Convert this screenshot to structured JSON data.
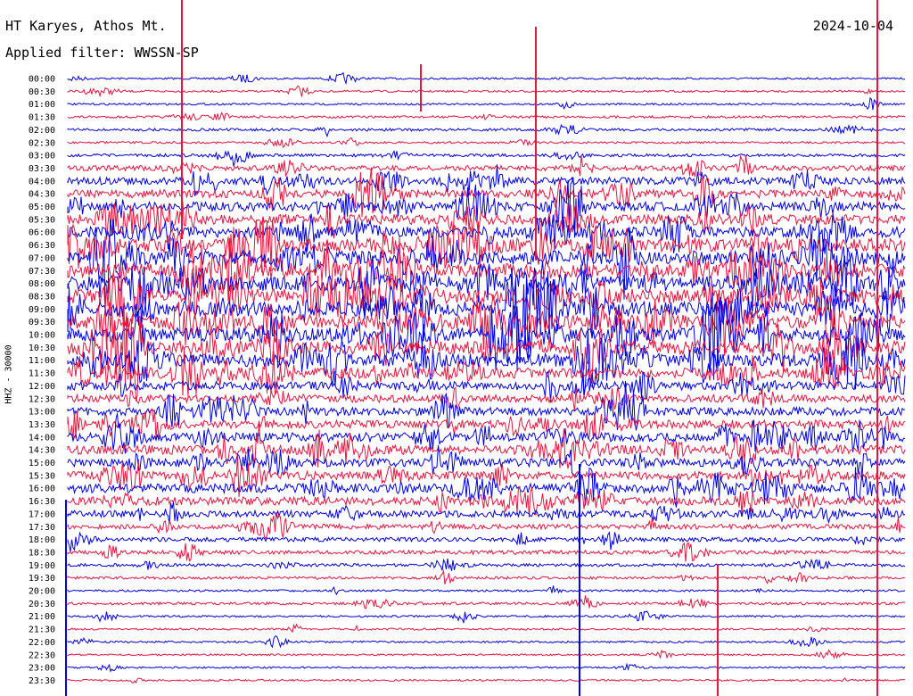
{
  "header": {
    "station": "HT Karyes, Athos Mt.",
    "filter": "Applied filter: WWSSN-SP",
    "date": "2024-10-04",
    "channel": "HHZ - 30000"
  },
  "chart_data": {
    "type": "line",
    "title": "HT Karyes, Athos Mt.",
    "subtitle": "Applied filter: WWSSN-SP",
    "date": "2024-10-04",
    "ylabel": "HHZ - 30000",
    "row_labels": [
      "00:00",
      "00:30",
      "01:00",
      "01:30",
      "02:00",
      "02:30",
      "03:00",
      "03:30",
      "04:00",
      "04:30",
      "05:00",
      "05:30",
      "06:00",
      "06:30",
      "07:00",
      "07:30",
      "08:00",
      "08:30",
      "09:00",
      "09:30",
      "10:00",
      "10:30",
      "11:00",
      "11:30",
      "12:00",
      "12:30",
      "13:00",
      "13:30",
      "14:00",
      "14:30",
      "15:00",
      "15:30",
      "16:00",
      "16:30",
      "17:00",
      "17:30",
      "18:00",
      "18:30",
      "19:00",
      "19:30",
      "20:00",
      "20:30",
      "21:00",
      "21:30",
      "22:00",
      "22:30",
      "23:00",
      "23:30"
    ],
    "row_minutes": 30,
    "colors": [
      "#0000e6",
      "#e8153e"
    ],
    "relative_activity": [
      0.05,
      0.06,
      0.05,
      0.08,
      0.1,
      0.06,
      0.12,
      0.25,
      0.4,
      0.45,
      0.5,
      0.55,
      0.6,
      0.75,
      0.8,
      0.8,
      0.85,
      0.85,
      0.85,
      0.8,
      0.8,
      0.78,
      0.75,
      0.6,
      0.45,
      0.4,
      0.45,
      0.45,
      0.5,
      0.5,
      0.45,
      0.45,
      0.5,
      0.45,
      0.35,
      0.25,
      0.2,
      0.18,
      0.12,
      0.1,
      0.06,
      0.1,
      0.05,
      0.05,
      0.05,
      0.04,
      0.04,
      0.04
    ]
  }
}
